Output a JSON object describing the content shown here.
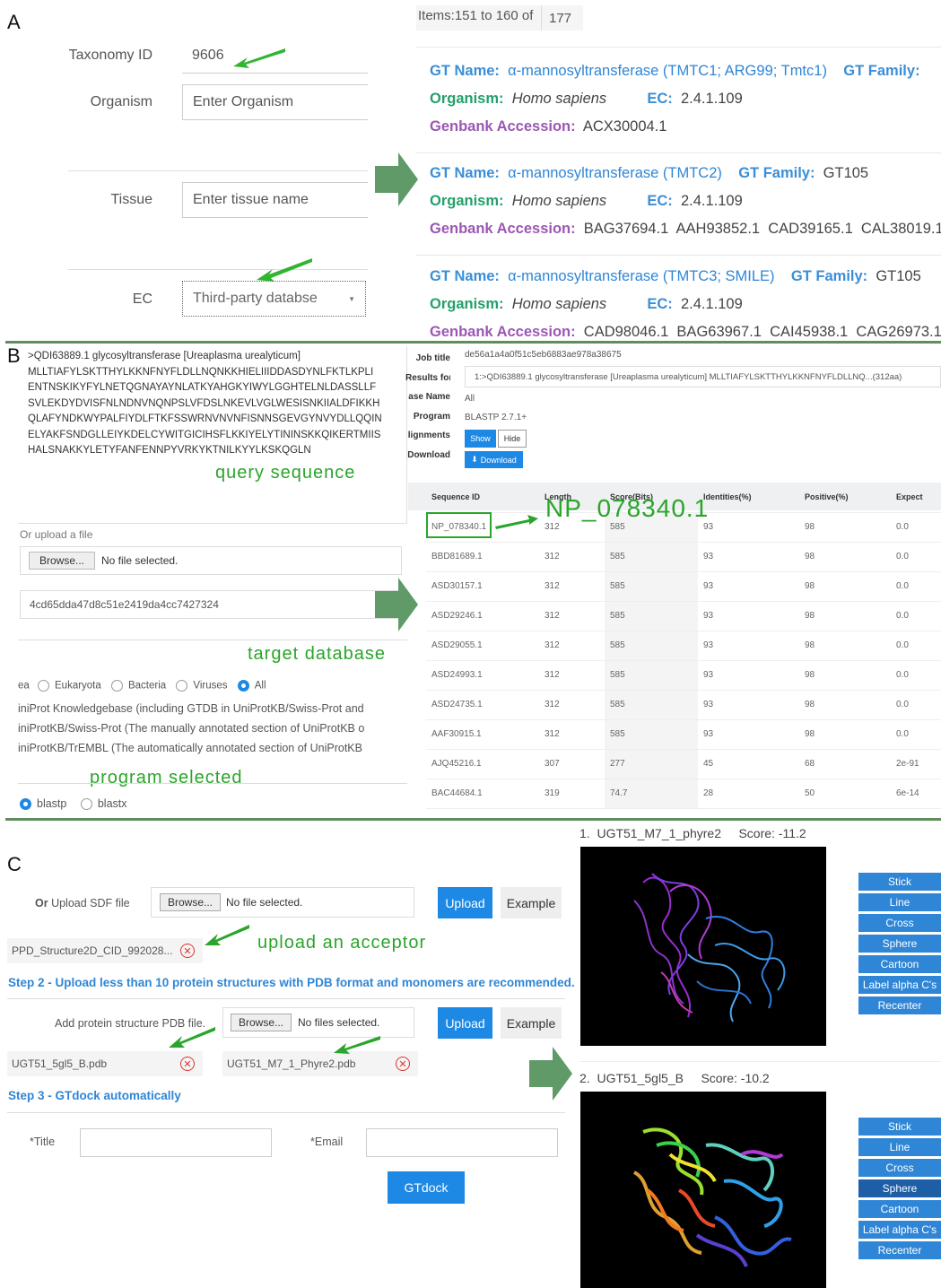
{
  "panelA": {
    "letter": "A",
    "taxonomy": {
      "label": "Taxonomy ID",
      "value": "9606"
    },
    "organism": {
      "label": "Organism",
      "placeholder": "Enter Organism"
    },
    "tissue": {
      "label": "Tissue",
      "placeholder": "Enter tissue name"
    },
    "ec": {
      "label": "EC",
      "value": "Third-party databse"
    },
    "pagination": {
      "items": "Items:151 to 160 of",
      "total": "177"
    },
    "results": [
      {
        "gt_name_label": "GT Name:",
        "gt_name": "α-mannosyltransferase (TMTC1; ARG99; Tmtc1)",
        "family_label": "GT Family:",
        "family": "",
        "organism_label": "Organism:",
        "organism": "Homo sapiens",
        "ec_label": "EC:",
        "ec": "2.4.1.109",
        "genbank_label": "Genbank Accession:",
        "genbank": "ACX30004.1"
      },
      {
        "gt_name_label": "GT Name:",
        "gt_name": "α-mannosyltransferase (TMTC2)",
        "family_label": "GT Family:",
        "family": "GT105",
        "organism_label": "Organism:",
        "organism": "Homo sapiens",
        "ec_label": "EC:",
        "ec": "2.4.1.109",
        "genbank_label": "Genbank Accession:",
        "genbank": "BAG37694.1  AAH93852.1  CAD39165.1  CAL38019.1"
      },
      {
        "gt_name_label": "GT Name:",
        "gt_name": "α-mannosyltransferase (TMTC3; SMILE)",
        "family_label": "GT Family:",
        "family": "GT105",
        "organism_label": "Organism:",
        "organism": "Homo sapiens",
        "ec_label": "EC:",
        "ec": "2.4.1.109",
        "genbank_label": "Genbank Accession:",
        "genbank": "CAD98046.1  BAG63967.1  CAI45938.1  CAG26973.1"
      }
    ]
  },
  "panelB": {
    "letter": "B",
    "query_lines": [
      ">QDI63889.1 glycosyltransferase [Ureaplasma urealyticum]",
      "MLLTIAFYLSKTTHYLKKNFNYFLDLLNQNKKHIELIIIDDASDYNLFKTLKPLI",
      "ENTNSKIKYFYLNETQGNAYAYNLATKYAHGKYIWYLGGHTELNLDASSLLF",
      "SVLEKDYDVISFNLNDNVNQNPSLVFDSLNKEVLVGLWESISNKIIALDFIKKH",
      "QLAFYNDKWYPALFIYDLFTKFSSWRNVNVNFISNNSGEVGYNVYDLLQQIN",
      "ELYAKFSNDGLLEIYKDELCYWITGICIHSFLKKIYELYTININSKKQIKERTMIIS",
      "HALSNAKKYLETYFANFENNPYVRKYKTNILKYYLKSKQGLN"
    ],
    "query_tag": "query sequence",
    "upload_label": "Or upload a file",
    "browse": "Browse...",
    "no_file": "No file selected.",
    "hash": "4cd65dda47d8c51e2419da4cc7427324",
    "target_tag": "target database",
    "radios": {
      "prefix": "ea",
      "items": [
        "Eukaryota",
        "Bacteria",
        "Viruses",
        "All"
      ],
      "selected": "All"
    },
    "db_lines": [
      "iniProt Knowledgebase (including GTDB in UniProtKB/Swiss-Prot and",
      "iniProtKB/Swiss-Prot (The manually annotated section of UniProtKB o",
      "iniProtKB/TrEMBL (The automatically annotated section of UniProtKB"
    ],
    "program_tag": "program selected",
    "programs": [
      "blastp",
      "blastx"
    ],
    "job": {
      "labels": [
        "Job title",
        "Results for",
        "ase Name",
        "Program",
        "lignments",
        "Download"
      ],
      "job_title": "de56a1a4a0f51c5eb6883ae978a38675",
      "results_for": "1:>QDI63889.1 glycosyltransferase [Ureaplasma urealyticum] MLLTIAFYLSKTTHYLKKNFNYFLDLLNQ...(312aa)",
      "db_name": "All",
      "program": "BLASTP 2.7.1+",
      "show": "Show",
      "hide": "Hide",
      "download": "Download"
    },
    "highlight": "NP_078340.1",
    "table": {
      "headers": [
        "Sequence ID",
        "Length",
        "Score(Bits)",
        "Identities(%)",
        "Positive(%)",
        "Expect"
      ],
      "rows": [
        [
          "NP_078340.1",
          "312",
          "585",
          "93",
          "98",
          "0.0"
        ],
        [
          "BBD81689.1",
          "312",
          "585",
          "93",
          "98",
          "0.0"
        ],
        [
          "ASD30157.1",
          "312",
          "585",
          "93",
          "98",
          "0.0"
        ],
        [
          "ASD29246.1",
          "312",
          "585",
          "93",
          "98",
          "0.0"
        ],
        [
          "ASD29055.1",
          "312",
          "585",
          "93",
          "98",
          "0.0"
        ],
        [
          "ASD24993.1",
          "312",
          "585",
          "93",
          "98",
          "0.0"
        ],
        [
          "ASD24735.1",
          "312",
          "585",
          "93",
          "98",
          "0.0"
        ],
        [
          "AAF30915.1",
          "312",
          "585",
          "93",
          "98",
          "0.0"
        ],
        [
          "AJQ45216.1",
          "307",
          "277",
          "45",
          "68",
          "2e-91"
        ],
        [
          "BAC44684.1",
          "319",
          "74.7",
          "28",
          "50",
          "6e-14"
        ]
      ]
    }
  },
  "panelC": {
    "letter": "C",
    "sdf": {
      "prefix": "Or",
      "label": "Upload SDF file",
      "browse": "Browse...",
      "no_file": "No file selected.",
      "upload": "Upload",
      "example": "Example"
    },
    "acceptor_file": "PPD_Structure2D_CID_992028...",
    "acceptor_tag": "upload an acceptor",
    "step2": "Step 2 - Upload less than 10 protein structures with PDB format and monomers are recommended.",
    "pdb": {
      "label": "Add protein structure PDB file.",
      "browse": "Browse...",
      "no_file": "No files selected.",
      "upload": "Upload",
      "example": "Example"
    },
    "pdb_files": [
      "UGT51_5gl5_B.pdb",
      "UGT51_M7_1_Phyre2.pdb"
    ],
    "step3": "Step 3 - GTdock automatically",
    "title_label": "*Title",
    "email_label": "*Email",
    "gtdock": "GTdock",
    "results": [
      {
        "index": "1.",
        "name": "UGT51_M7_1_phyre2",
        "score": "Score: -11.2"
      },
      {
        "index": "2.",
        "name": "UGT51_5gl5_B",
        "score": "Score: -10.2"
      }
    ],
    "viewer_buttons": [
      "Stick",
      "Line",
      "Cross",
      "Sphere",
      "Cartoon",
      "Label alpha C's",
      "Recenter"
    ]
  }
}
